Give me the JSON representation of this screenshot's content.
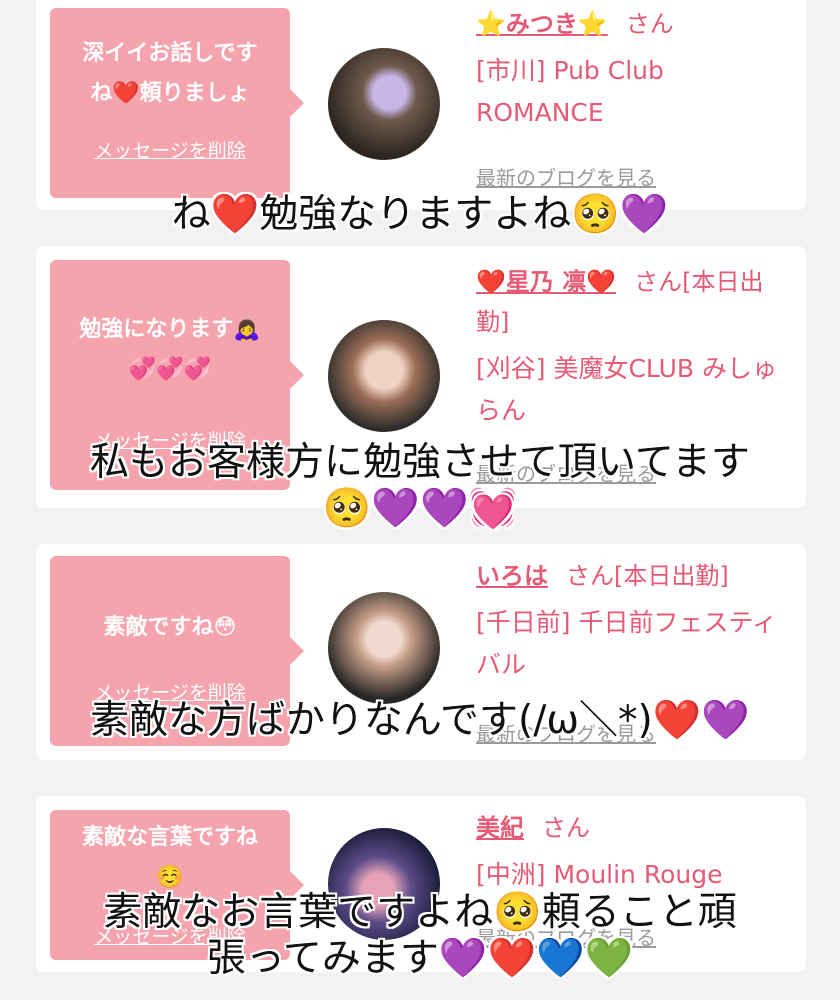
{
  "cards": [
    {
      "message": "深イイお話しです\nね❤️頼りましょ",
      "delete_label": "メッセージを削除",
      "girl_name": "⭐️みつき⭐️",
      "san_label": "さん",
      "shop": "[市川] Pub Club ROMANCE",
      "blog_label": "最新のブログを見る"
    },
    {
      "message": "勉強になります🙇‍♀️\n💞💞💞",
      "delete_label": "メッセージを削除",
      "girl_name": "❤️星乃 凛❤️",
      "san_label": "さん[本日出勤]",
      "shop": "[刈谷] 美魔女CLUB みしゅらん",
      "blog_label": "最新のブログを見る"
    },
    {
      "message": "素敵ですね😳",
      "delete_label": "メッセージを削除",
      "girl_name": "いろは",
      "san_label": "さん[本日出勤]",
      "shop": "[千日前] 千日前フェスティバル",
      "blog_label": "最新のブログを見る"
    },
    {
      "message": "素敵な言葉ですね\n☺️",
      "delete_label": "メッセージを削除",
      "girl_name": "美紀",
      "san_label": "さん",
      "shop": "[中洲] Moulin Rouge",
      "blog_label": "最新のブログを見る"
    }
  ],
  "captions": [
    "ね❤️勉強なりますよね🥺💜",
    "私もお客様方に勉強させて頂いてます\n🥺💜💜💓",
    "素敵な方ばかりなんです(/ω＼*)❤️💜",
    "素敵なお言葉ですよね🥺頼ること頑\n張ってみます💜❤️💙💚"
  ],
  "colors": {
    "bubble": "#f5a3ac",
    "accent": "#e55a75",
    "link_gray": "#9a9a9a"
  }
}
